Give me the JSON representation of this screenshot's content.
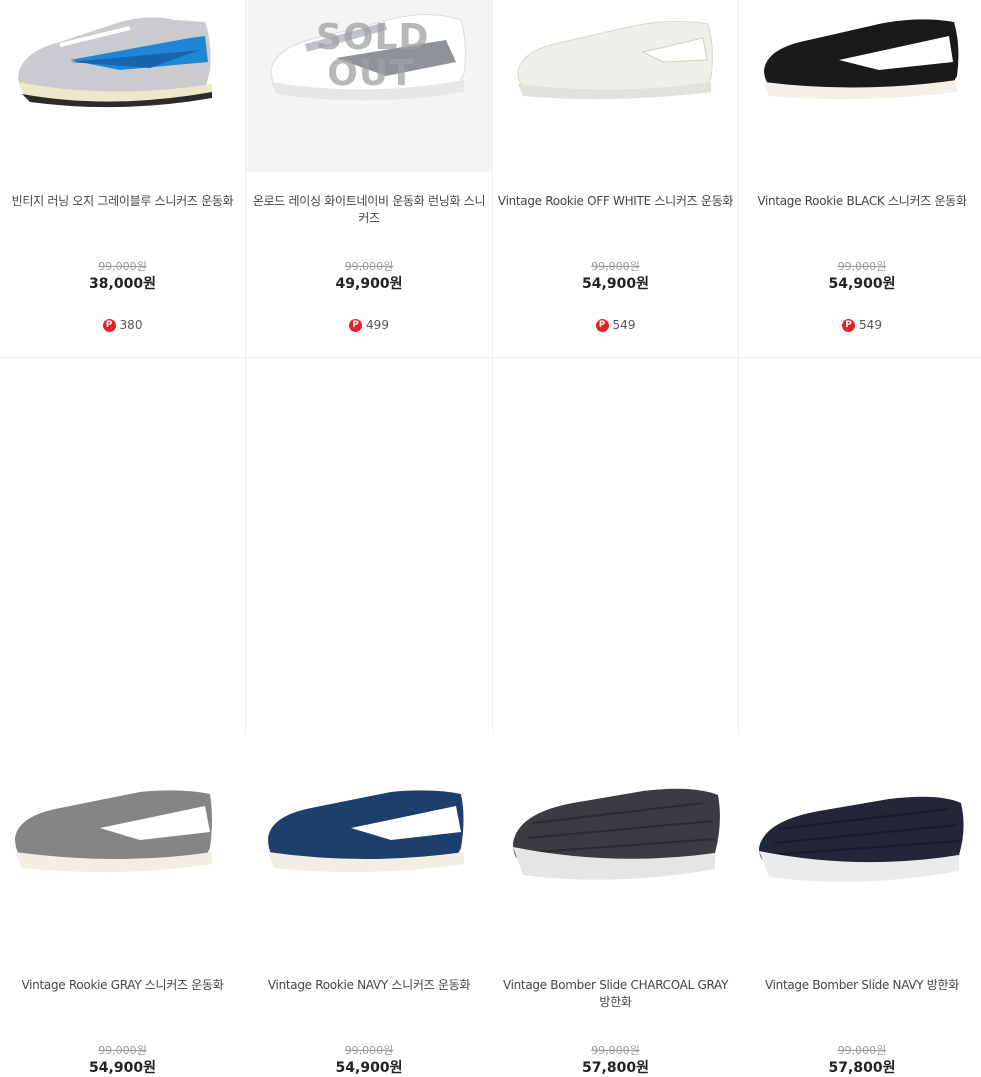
{
  "products": [
    {
      "name": "빈티지 러닝 오지 그레이블루 스니커즈 운동화",
      "orig_price": "99,000원",
      "price": "38,000원",
      "points": "380",
      "soldout_label": ""
    },
    {
      "name": "온로드 레이싱 화이트네이비 운동화 런닝화 스니커즈",
      "orig_price": "99,000원",
      "price": "49,900원",
      "points": "499",
      "soldout_label": "SOLD\nOUT"
    },
    {
      "name": "Vintage Rookie OFF WHITE 스니커즈 운동화",
      "orig_price": "99,000원",
      "price": "54,900원",
      "points": "549",
      "soldout_label": ""
    },
    {
      "name": "Vintage Rookie BLACK 스니커즈 운동화",
      "orig_price": "99,000원",
      "price": "54,900원",
      "points": "549",
      "soldout_label": ""
    },
    {
      "name": "Vintage Rookie GRAY 스니커즈 운동화",
      "orig_price": "99,000원",
      "price": "54,900원"
    },
    {
      "name": "Vintage Rookie NAVY 스니커즈 운동화",
      "orig_price": "99,000원",
      "price": "54,900원"
    },
    {
      "name": "Vintage Bomber Slide CHARCOAL GRAY 방한화",
      "orig_price": "99,000원",
      "price": "57,800원"
    },
    {
      "name": "Vintage Bomber Slide NAVY 방한화",
      "orig_price": "99,000원",
      "price": "57,800원"
    }
  ],
  "point_icon_label": "P",
  "colors": {
    "point_red": "#e8202a",
    "accent_blue": "#1f86d6"
  }
}
